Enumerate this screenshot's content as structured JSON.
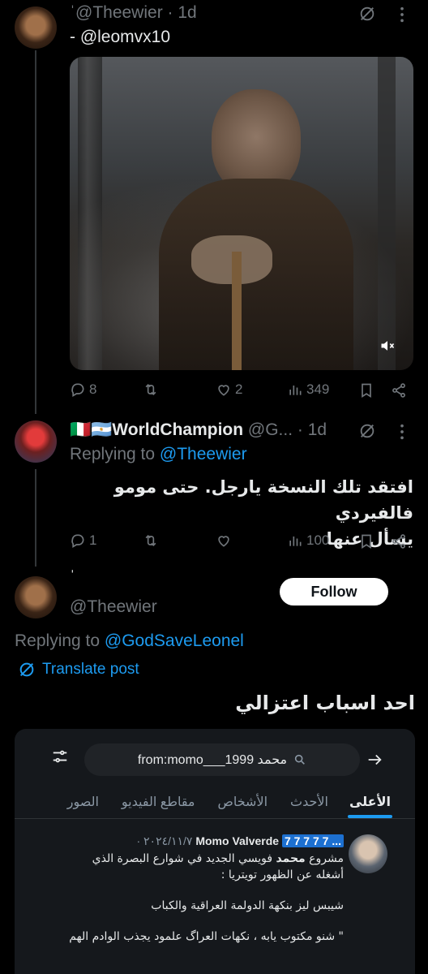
{
  "post1": {
    "handle": "@Theewier",
    "time": "1d",
    "dot": "·",
    "quote_mark": "ˈ",
    "replying_text": "- @leomvx10",
    "metrics": {
      "replies": "8",
      "reposts": "",
      "likes": "2",
      "views": "349"
    }
  },
  "post2": {
    "display_name": "🇮🇹🇦🇷WorldChampion",
    "handle": "@G...",
    "time": "1d",
    "dot": "·",
    "replying_prefix": "Replying to",
    "replying_handle": "@Theewier",
    "text_line1": "افتقد تلك النسخة يارجل. حتى مومو فالفيردي",
    "text_line2": "يسأل عنها",
    "metrics": {
      "replies": "1",
      "reposts": "",
      "likes": "",
      "views": "100"
    }
  },
  "post3": {
    "name_mark": "ˈ",
    "handle": "@Theewier",
    "follow_label": "Follow",
    "replying_prefix": "Replying to",
    "replying_handle": "@GodSaveLeonel",
    "translate_label": "Translate post",
    "text": "احد اسباب اعتزالي"
  },
  "embedded": {
    "search_value": "from:momo___1999 محمد",
    "tabs": [
      "الأعلى",
      "الأحدث",
      "الأشخاص",
      "مقاطع الفيديو",
      "الصور"
    ],
    "active_tab": "الأعلى",
    "tweet": {
      "name": "Momo Valverde",
      "badges": "7 7 7 7 7 ...",
      "date": "٢٠٢٤/١١/٧ ·",
      "line1_prefix": "مشروع",
      "line1_highlight": "محمد",
      "line1_rest": "فويسي الجديد في شوارع البصرة الذي",
      "line2": "أشغله عن الظهور تويتريا :",
      "line3": "شيبس ليز بنكهة الدولمة العراقية والكباب",
      "line4": "\" شنو مكتوب يابه ، نكهات العراگ علمود يجذب الوادم الهم"
    }
  },
  "colors": {
    "background": "#000000",
    "text": "#e7e9ea",
    "muted": "#71767b",
    "accent": "#1d9bf0",
    "divider": "#2f3336",
    "embed_bg": "#15181c"
  },
  "icons": {
    "grok": "grok-icon",
    "more": "more-icon",
    "reply": "reply-icon",
    "repost": "repost-icon",
    "like": "like-icon",
    "views": "views-icon",
    "bookmark": "bookmark-icon",
    "share": "share-icon",
    "mute": "mute-icon",
    "translate": "translate-icon"
  }
}
